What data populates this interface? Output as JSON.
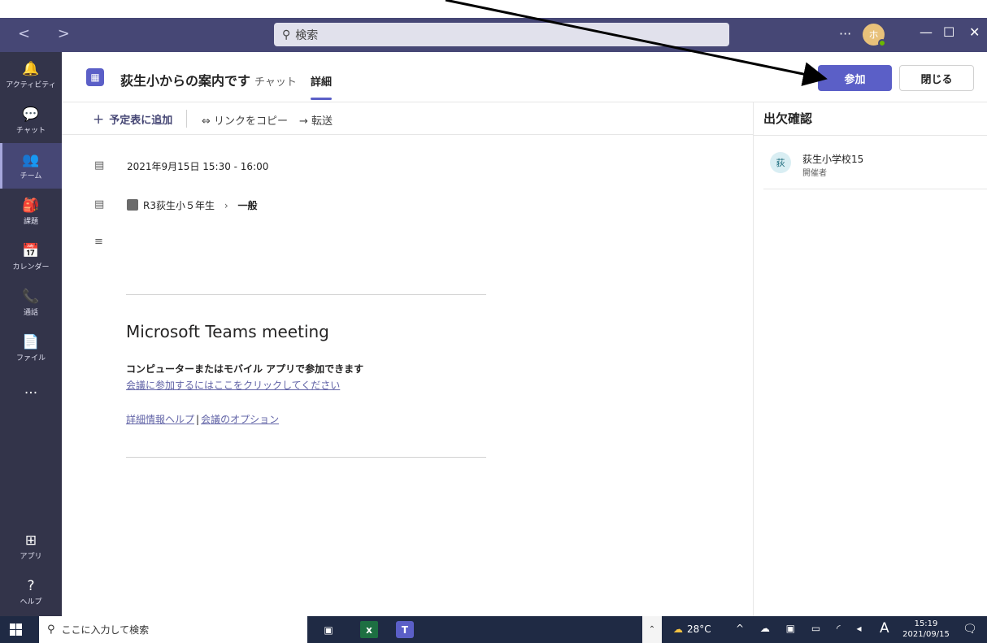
{
  "titlebar": {
    "nav": "<  >",
    "search_placeholder": "検索",
    "more": "···",
    "avatar_initial": "ホ",
    "minimize": "—",
    "maximize": "☐",
    "close": "✕"
  },
  "rail": [
    {
      "label": "アクティビティ",
      "icon": "bell-icon",
      "glyph": "🔔"
    },
    {
      "label": "チャット",
      "icon": "chat-icon",
      "glyph": "💬"
    },
    {
      "label": "チーム",
      "icon": "teams-icon",
      "glyph": "👥"
    },
    {
      "label": "課題",
      "icon": "assignments-icon",
      "glyph": "🎒"
    },
    {
      "label": "カレンダー",
      "icon": "calendar-icon",
      "glyph": "📅"
    },
    {
      "label": "通話",
      "icon": "phone-icon",
      "glyph": "📞"
    },
    {
      "label": "ファイル",
      "icon": "file-icon",
      "glyph": "📄"
    },
    {
      "label": "",
      "icon": "more-apps-icon",
      "glyph": "···"
    },
    {
      "label": "アプリ",
      "icon": "apps-icon",
      "glyph": "⊞"
    },
    {
      "label": "ヘルプ",
      "icon": "help-icon",
      "glyph": "?"
    }
  ],
  "header": {
    "title": "荻生小からの案内です",
    "tab_chat": "チャット",
    "tab_detail": "詳細",
    "join_label": "参加",
    "close_label": "閉じる"
  },
  "toolbar": {
    "add_label": "予定表に追加",
    "copy_label": "⇔ リンクをコピー",
    "forward_label": "→ 転送"
  },
  "details": {
    "datetime": "2021年9月15日 15:30 - 16:00",
    "team": "R3荻生小５年生",
    "channel_sep": "›",
    "channel": "一般"
  },
  "meeting": {
    "title": "Microsoft Teams meeting",
    "subtitle": "コンピューターまたはモバイル アプリで参加できます",
    "join_link": "会議に参加するにはここをクリックしてください",
    "help_link": "詳細情報ヘルプ",
    "separator": "|",
    "options_link": "会議のオプション"
  },
  "attendance": {
    "title": "出欠確認",
    "organizer_initial": "荻",
    "organizer_name": "荻生小学校15",
    "organizer_role": "開催者"
  },
  "taskbar": {
    "search_placeholder": "ここに入力して検索",
    "excel": "x",
    "teams": "T",
    "weather": "28°C",
    "tray_glyphs": "^ ☁ ▣ ▭ ◜ ◂",
    "ime": "A",
    "time": "15:19",
    "date": "2021/09/15"
  },
  "colors": {
    "titlebar": "#464775",
    "rail": "#33344a",
    "accent": "#5b5fc7",
    "link": "#6264a7"
  }
}
